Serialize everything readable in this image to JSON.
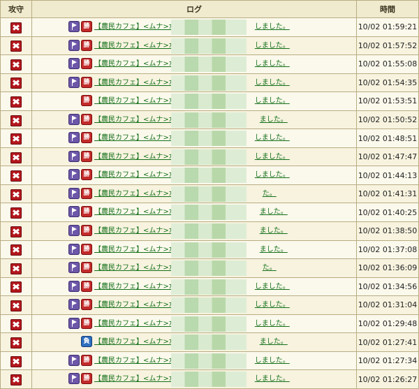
{
  "header": {
    "attack_defense": "攻守",
    "log": "ログ",
    "time": "時間"
  },
  "log_prefix": "【農民カフェ】<ムナ>が",
  "rows": [
    {
      "flag": true,
      "result": "勝",
      "suffix": "しました。",
      "time": "10/02 01:59:21"
    },
    {
      "flag": true,
      "result": "勝",
      "suffix": "しました。",
      "time": "10/02 01:57:52"
    },
    {
      "flag": true,
      "result": "勝",
      "suffix": "しました。",
      "time": "10/02 01:55:08"
    },
    {
      "flag": true,
      "result": "勝",
      "suffix": "しました。",
      "time": "10/02 01:54:35"
    },
    {
      "flag": false,
      "result": "勝",
      "suffix": "しました。",
      "time": "10/02 01:53:51"
    },
    {
      "flag": true,
      "result": "勝",
      "suffix": "ました。",
      "time": "10/02 01:50:52"
    },
    {
      "flag": true,
      "result": "勝",
      "suffix": "しました。",
      "time": "10/02 01:48:51"
    },
    {
      "flag": true,
      "result": "勝",
      "suffix": "しました。",
      "time": "10/02 01:47:47"
    },
    {
      "flag": true,
      "result": "勝",
      "suffix": "しました。",
      "time": "10/02 01:44:13"
    },
    {
      "flag": true,
      "result": "勝",
      "suffix": "た。",
      "time": "10/02 01:41:31"
    },
    {
      "flag": true,
      "result": "勝",
      "suffix": "ました。",
      "time": "10/02 01:40:25"
    },
    {
      "flag": true,
      "result": "勝",
      "suffix": "ました。",
      "time": "10/02 01:38:50"
    },
    {
      "flag": true,
      "result": "勝",
      "suffix": "ました。",
      "time": "10/02 01:37:08"
    },
    {
      "flag": true,
      "result": "勝",
      "suffix": "た。",
      "time": "10/02 01:36:09"
    },
    {
      "flag": true,
      "result": "勝",
      "suffix": "しました。",
      "time": "10/02 01:34:56"
    },
    {
      "flag": true,
      "result": "勝",
      "suffix": "しました。",
      "time": "10/02 01:31:04"
    },
    {
      "flag": true,
      "result": "勝",
      "suffix": "しました。",
      "time": "10/02 01:29:48"
    },
    {
      "flag": false,
      "result": "負",
      "suffix": "ました。",
      "time": "10/02 01:27:41"
    },
    {
      "flag": true,
      "result": "勝",
      "suffix": "しました。",
      "time": "10/02 01:27:34"
    },
    {
      "flag": true,
      "result": "勝",
      "suffix": "しました。",
      "time": "10/02 01:26:27"
    }
  ]
}
